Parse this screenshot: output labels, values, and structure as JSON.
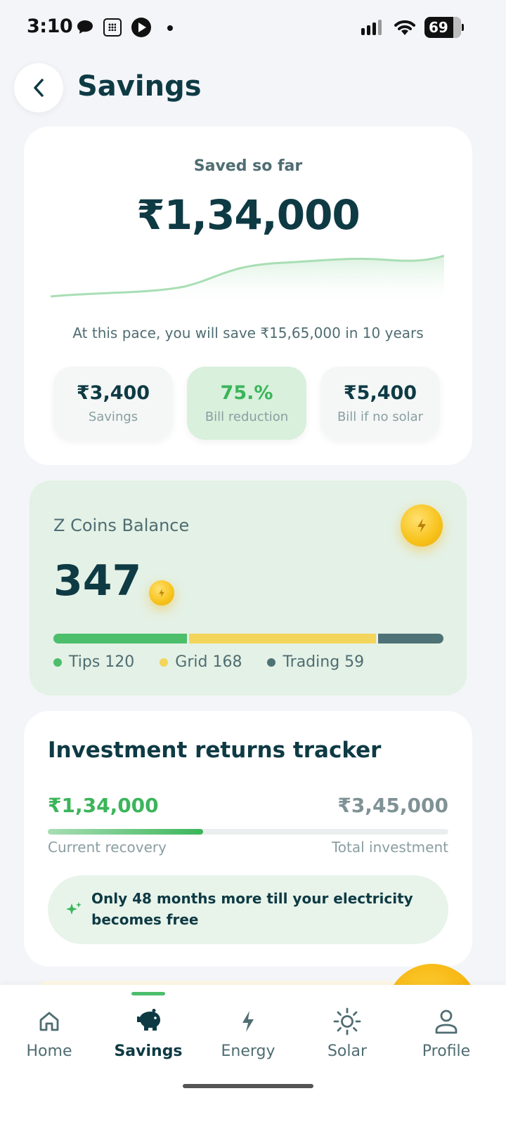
{
  "status_bar": {
    "time": "3:10",
    "battery": "69",
    "icons": [
      "chat-bubble-icon",
      "calculator-icon",
      "play-icon",
      "notification-dot-icon",
      "signal-icon",
      "wifi-icon",
      "battery-icon"
    ]
  },
  "header": {
    "title": "Savings",
    "back_icon": "chevron-left-icon"
  },
  "saved": {
    "label": "Saved so far",
    "amount": "₹1,34,000",
    "pace_text": "At this pace, you will save ₹15,65,000 in 10 years",
    "trend_color": "#a8deb4",
    "stats": [
      {
        "value": "₹3,400",
        "label": "Savings"
      },
      {
        "value": "75.%",
        "label": "Bill reduction"
      },
      {
        "value": "₹5,400",
        "label": "Bill if no solar"
      }
    ]
  },
  "coins": {
    "title": "Z Coins Balance",
    "value": "347",
    "segments": [
      {
        "label": "Tips 120",
        "value": 120,
        "color": "#4cbe6c"
      },
      {
        "label": "Grid 168",
        "value": 168,
        "color": "#f3d55b"
      },
      {
        "label": "Trading 59",
        "value": 59,
        "color": "#4f7276"
      }
    ]
  },
  "investment": {
    "title": "Investment returns tracker",
    "current_value": "₹1,34,000",
    "total_value": "₹3,45,000",
    "current_label": "Current recovery",
    "total_label": "Total investment",
    "recovery_fraction": 0.388,
    "note": "Only 48 months more till your electricity becomes free"
  },
  "nav": {
    "items": [
      {
        "label": "Home",
        "icon": "home-icon"
      },
      {
        "label": "Savings",
        "icon": "piggy-bank-icon"
      },
      {
        "label": "Energy",
        "icon": "lightning-icon"
      },
      {
        "label": "Solar",
        "icon": "sun-icon"
      },
      {
        "label": "Profile",
        "icon": "profile-icon"
      }
    ],
    "active": "Savings"
  },
  "colors": {
    "primary_dark": "#0e3a44",
    "accent_green": "#3bb55a",
    "coin_gold": "#f7c21a"
  }
}
